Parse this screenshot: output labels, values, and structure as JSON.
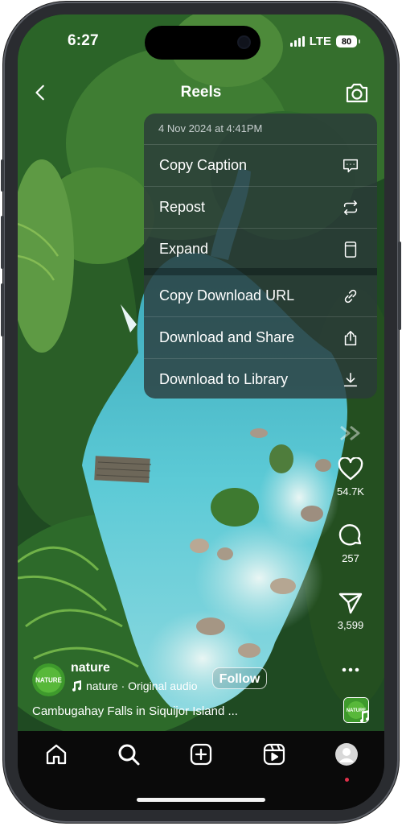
{
  "status_bar": {
    "time": "6:27",
    "network": "LTE",
    "battery": "80"
  },
  "header": {
    "title": "Reels",
    "back_icon": "chevron-left-icon",
    "camera_icon": "camera-icon"
  },
  "context_menu": {
    "date": "4 Nov 2024 at 4:41PM",
    "group1": [
      {
        "label": "Copy Caption",
        "icon": "caption-bubble-icon"
      },
      {
        "label": "Repost",
        "icon": "repost-icon"
      },
      {
        "label": "Expand",
        "icon": "expand-icon"
      }
    ],
    "group2": [
      {
        "label": "Copy Download URL",
        "icon": "link-icon"
      },
      {
        "label": "Download and Share",
        "icon": "share-icon"
      },
      {
        "label": "Download to Library",
        "icon": "download-icon"
      }
    ]
  },
  "actions": {
    "likes": "54.7K",
    "comments": "257",
    "shares": "3,599"
  },
  "post": {
    "username": "nature",
    "avatar_text": "NATURE",
    "audio": "nature · Original audio",
    "follow_label": "Follow",
    "caption": "Cambugahay Falls in Siquijor Island ..."
  },
  "bottom_nav": [
    "home-icon",
    "search-icon",
    "create-icon",
    "reels-icon",
    "profile-icon"
  ],
  "colors": {
    "water": "#5cc6d2",
    "foliage": "#2f6b2c",
    "menu_bg": "#2a3a3a",
    "notification_dot": "#e0304a"
  }
}
